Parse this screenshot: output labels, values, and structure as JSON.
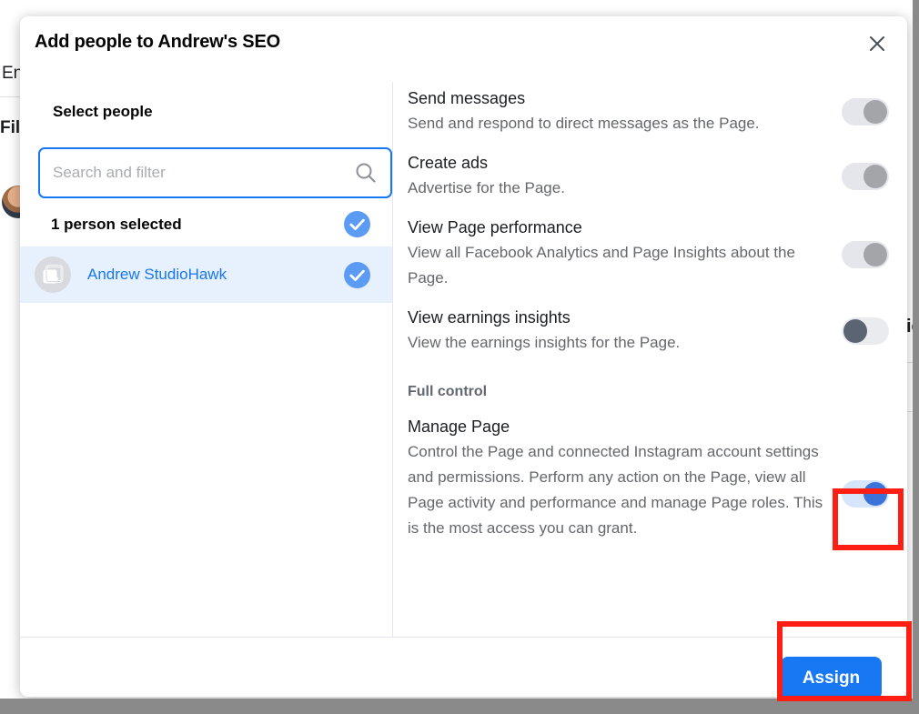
{
  "background": {
    "fragments": [
      {
        "text": "Ent",
        "bold": false
      },
      {
        "text": "Fil",
        "bold": true
      }
    ],
    "right_edge_text": "ie"
  },
  "dialog": {
    "title": "Add people to Andrew's SEO",
    "close_icon": "close-icon"
  },
  "left_pane": {
    "heading": "Select people",
    "search": {
      "value": "",
      "placeholder": "Search and filter",
      "icon": "search-icon"
    },
    "count_row": {
      "label": "1 person selected",
      "checked": true,
      "check_icon": "check-circle-icon"
    },
    "people": [
      {
        "name": "Andrew StudioHawk",
        "avatar_icon": "contact-card-icon",
        "checked": true,
        "check_icon": "check-circle-icon",
        "selected": true
      }
    ]
  },
  "right_pane": {
    "permissions": [
      {
        "title": "Send messages",
        "description": "Send and respond to direct messages as the Page.",
        "toggle_state": "disabled-on"
      },
      {
        "title": "Create ads",
        "description": "Advertise for the Page.",
        "toggle_state": "disabled-on"
      },
      {
        "title": "View Page performance",
        "description": "View all Facebook Analytics and Page Insights about the Page.",
        "toggle_state": "disabled-on"
      },
      {
        "title": "View earnings insights",
        "description": "View the earnings insights for the Page.",
        "toggle_state": "off"
      }
    ],
    "section_heading": "Full control",
    "full_control": {
      "title": "Manage Page",
      "description": "Control the Page and connected Instagram account settings and permissions. Perform any action on the Page, view all Page activity and performance and manage Page roles. This is the most access you can grant.",
      "toggle_state": "on"
    }
  },
  "footer": {
    "assign_label": "Assign"
  },
  "colors": {
    "accent": "#1877f2",
    "toggle_on_knob": "#3b73d8",
    "toggle_on_track": "#d7e5fb",
    "toggle_off_knob": "#5a6472",
    "toggle_disabled_knob": "#a3a5a9",
    "annotation": "#ff1e14",
    "selected_row": "#e7f0fd",
    "scrim": "#8a8a8a"
  }
}
